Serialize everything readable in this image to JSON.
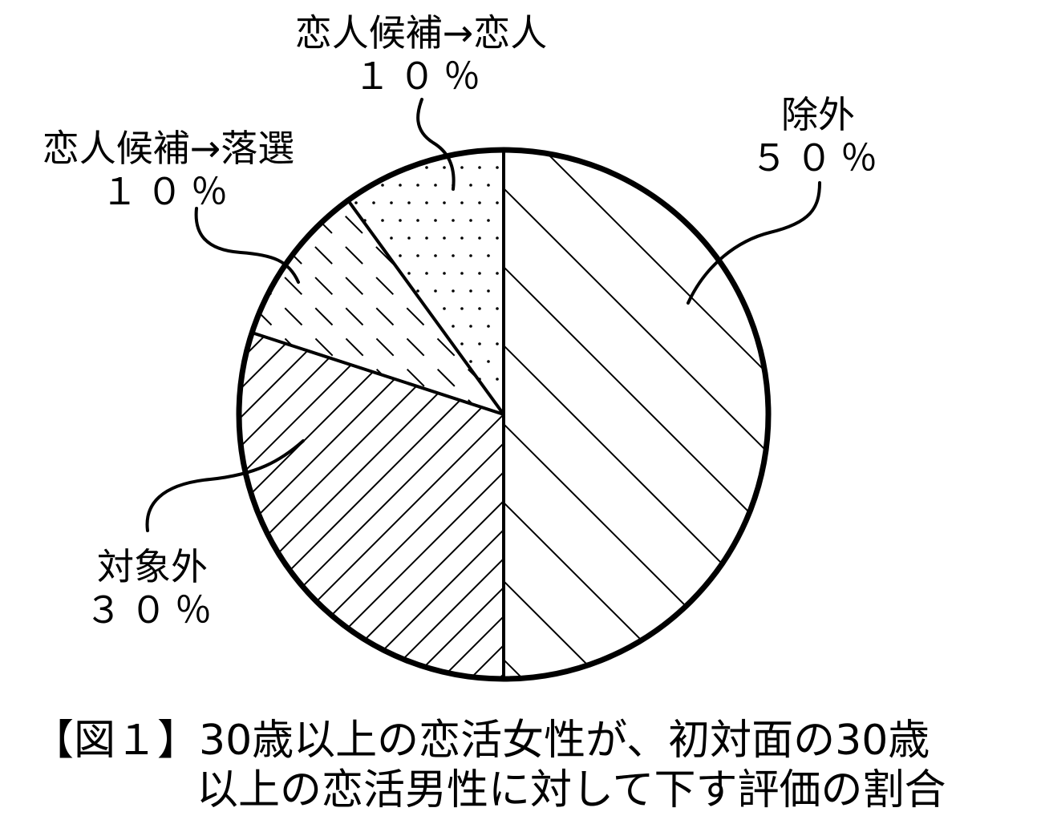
{
  "chart_data": {
    "type": "pie",
    "start": "12 o'clock",
    "direction": "clockwise",
    "slices": [
      {
        "name": "除外",
        "value": 50,
        "label": "除外",
        "value_label": "５０％",
        "pattern": "wide-diagonal-chevron"
      },
      {
        "name": "対象外",
        "value": 30,
        "label": "対象外",
        "value_label": "３０％",
        "pattern": "diagonal-hatch"
      },
      {
        "name": "恋人候補→落選",
        "value": 10,
        "label": "恋人候補→落選",
        "value_label": "１０％",
        "pattern": "dashed-hatch"
      },
      {
        "name": "恋人候補→恋人",
        "value": 10,
        "label": "恋人候補→恋人",
        "value_label": "１０％",
        "pattern": "dots"
      }
    ],
    "colors": {
      "stroke": "#000000",
      "fill": "#ffffff"
    }
  },
  "caption": {
    "line1": "【図１】30歳以上の恋活女性が、初対面の30歳",
    "line2": "以上の恋活男性に対して下す評価の割合"
  }
}
